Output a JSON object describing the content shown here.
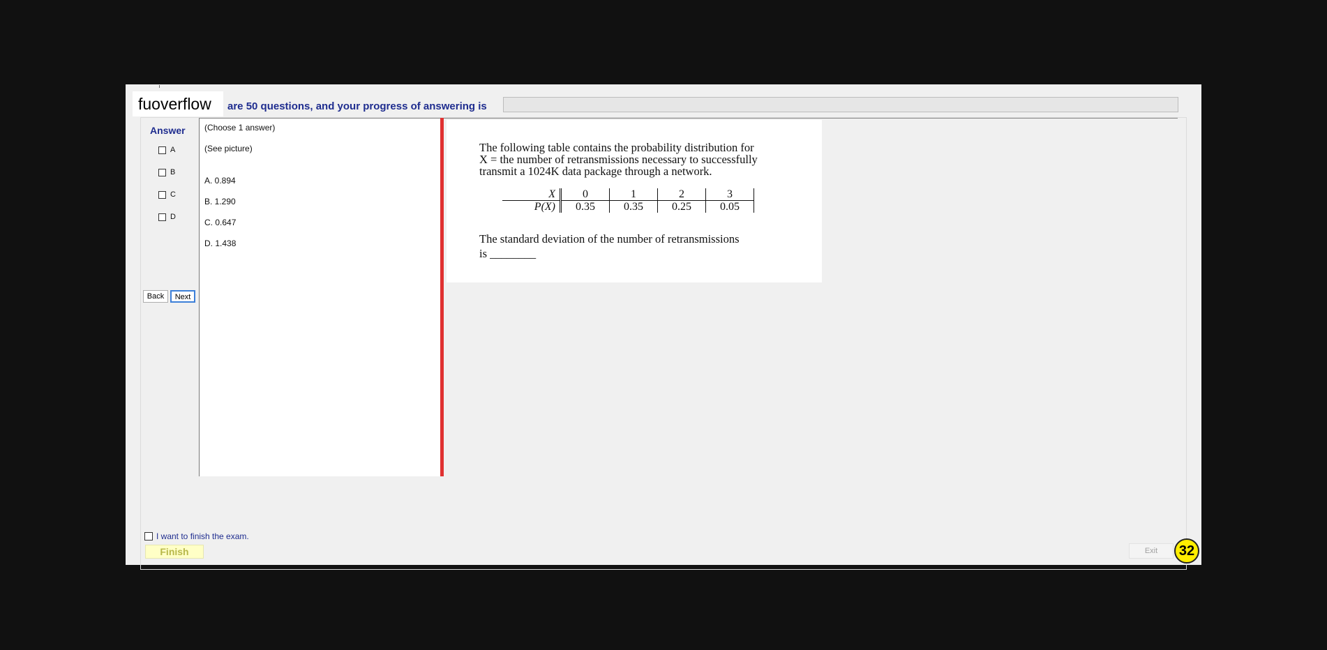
{
  "header": {
    "brand": "fuoverflow",
    "progress_text": "are 50 questions, and your progress of answering is",
    "progress_fraction": 0
  },
  "answer_panel": {
    "title": "Answer",
    "options": [
      "A",
      "B",
      "C",
      "D"
    ],
    "back_label": "Back",
    "next_label": "Next"
  },
  "question_text": {
    "instruction": "(Choose 1 answer)",
    "see_picture": "(See picture)",
    "choices": [
      "A.  0.894",
      "B.  1.290",
      "C.  0.647",
      "D.  1.438"
    ]
  },
  "question_image": {
    "intro_lines": [
      "The following table contains the probability distribution for",
      "X = the number of retransmissions necessary to successfully",
      "transmit a 1024K data package through a network."
    ],
    "table": {
      "row1_header": "X",
      "row2_header": "P(X)",
      "x_values": [
        "0",
        "1",
        "2",
        "3"
      ],
      "p_values": [
        "0.35",
        "0.35",
        "0.25",
        "0.05"
      ]
    },
    "question_line1": "The standard deviation of the number of retransmissions",
    "question_line2": "is ________"
  },
  "footer": {
    "finish_checkbox_label": "I want to finish the exam.",
    "finish_label": "Finish",
    "exit_label": "Exit",
    "badge_number": "32"
  },
  "colors": {
    "accent_text": "#1f2d8f",
    "splitter": "#e03131",
    "badge": "#ffee00",
    "finish_bg": "#ffffc6"
  }
}
